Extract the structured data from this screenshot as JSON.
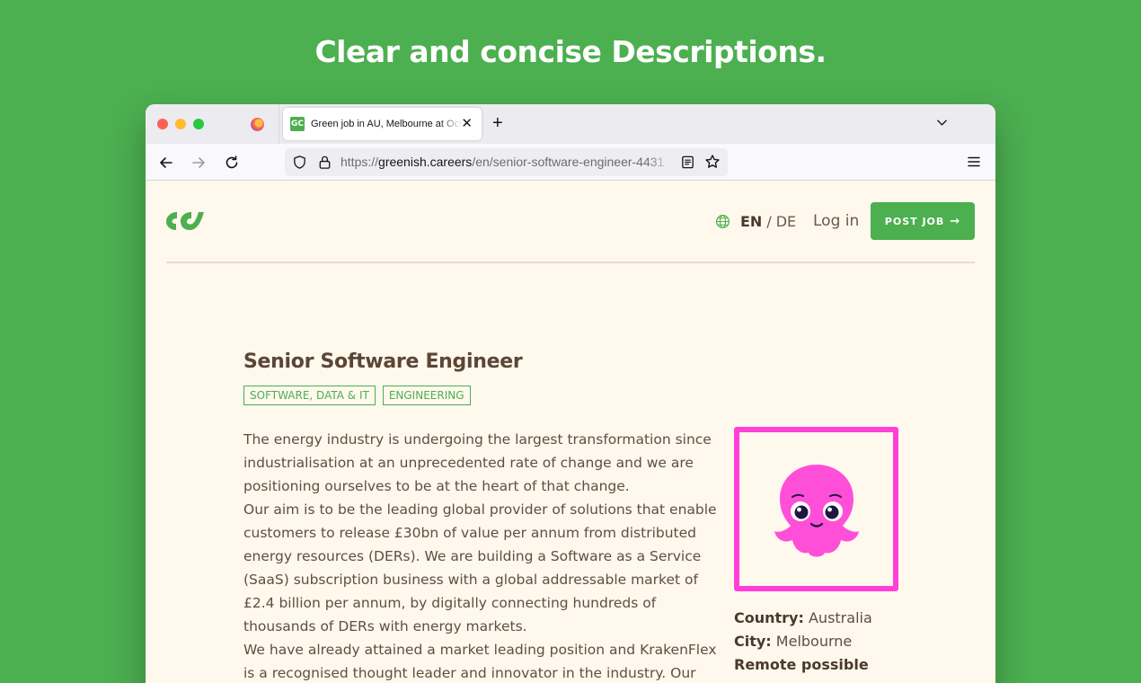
{
  "headline": "Clear and concise Descriptions.",
  "browser": {
    "tab": {
      "title": "Green job in AU, Melbourne at Octopus",
      "favicon_text": "GC"
    },
    "url": {
      "scheme": "https://",
      "domain": "greenish.careers",
      "path": "/en/senior-software-engineer-4431"
    }
  },
  "site": {
    "lang_current": "EN",
    "lang_separator": "/",
    "lang_other": "DE",
    "login_label": "Log in",
    "post_job_label": "POST JOB",
    "post_job_arrow": "→"
  },
  "job": {
    "title": "Senior Software Engineer",
    "tags": [
      "SOFTWARE, DATA & IT",
      "ENGINEERING"
    ],
    "description": [
      "The energy industry is undergoing the largest transformation since industrialisation at an unprecedented rate of change and we are positioning ourselves to be at the heart of that change.",
      "Our aim is to be the leading global provider of solutions that enable customers to release £30bn of value per annum from distributed energy resources (DERs). We are building a Software as a Service (SaaS) subscription business with a global addressable market of £2.4 billion per annum, by digitally connecting hundreds of thousands of DERs with energy markets.",
      "We have already attained a market leading position and KrakenFlex is a recognised thought leader and innovator in the industry. Our efforts"
    ],
    "meta": {
      "country_label": "Country:",
      "country_value": "Australia",
      "city_label": "City:",
      "city_value": "Melbourne",
      "remote_label": "Remote possible"
    }
  },
  "colors": {
    "background": "#4caf50",
    "accent": "#4caf50",
    "page_bg": "#fff8ed",
    "logo_border": "#ff3fd8",
    "octopus": "#ff4fd8"
  }
}
